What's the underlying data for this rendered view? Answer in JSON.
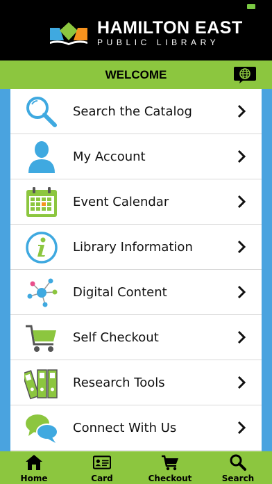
{
  "header": {
    "logo_title": "HAMILTON EAST",
    "logo_subtitle": "PUBLIC LIBRARY"
  },
  "welcome": {
    "title": "WELCOME"
  },
  "menu": {
    "items": [
      {
        "label": "Search the Catalog",
        "icon": "magnifier-icon"
      },
      {
        "label": "My Account",
        "icon": "person-icon"
      },
      {
        "label": "Event Calendar",
        "icon": "calendar-icon"
      },
      {
        "label": "Library Information",
        "icon": "info-icon"
      },
      {
        "label": "Digital Content",
        "icon": "network-icon"
      },
      {
        "label": "Self Checkout",
        "icon": "cart-icon"
      },
      {
        "label": "Research Tools",
        "icon": "binders-icon"
      },
      {
        "label": "Connect With Us",
        "icon": "speech-bubbles-icon"
      }
    ]
  },
  "tabbar": {
    "tabs": [
      {
        "label": "Home",
        "icon": "home-icon"
      },
      {
        "label": "Card",
        "icon": "card-icon"
      },
      {
        "label": "Checkout",
        "icon": "cart-icon"
      },
      {
        "label": "Search",
        "icon": "search-icon"
      }
    ]
  },
  "colors": {
    "brand_green": "#8cc63f",
    "side_blue": "#4aa3df",
    "icon_blue": "#3fa9e0"
  }
}
